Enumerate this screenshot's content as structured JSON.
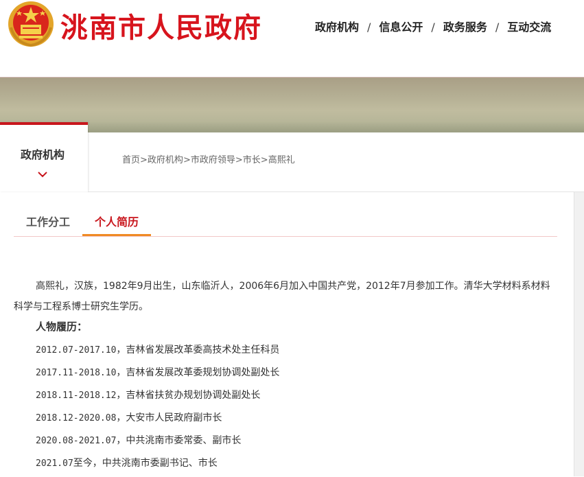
{
  "header": {
    "site_title": "洮南市人民政府",
    "emblem_icon": "national-emblem-icon",
    "nav": [
      "政府机构",
      "信息公开",
      "政务服务",
      "互动交流"
    ],
    "nav_separator": "/"
  },
  "colors": {
    "brand_red": "#c8161d",
    "tab_underline": "#f08a24"
  },
  "side_tab": {
    "label": "政府机构",
    "icon": "chevron-down-icon"
  },
  "breadcrumb": {
    "items": [
      "首页",
      "政府机构",
      "市政府领导",
      "市长",
      "高熙礼"
    ],
    "separator": ">"
  },
  "tabs": [
    {
      "label": "工作分工",
      "active": false
    },
    {
      "label": "个人简历",
      "active": true
    }
  ],
  "profile": {
    "intro": "高熙礼，汉族，1982年9月出生，山东临沂人，2006年6月加入中国共产党，2012年7月参加工作。清华大学材料系材料科学与工程系博士研究生学历。",
    "resume_heading": "人物履历：",
    "resume": [
      {
        "period": "2012.07-2017.10",
        "text": "，吉林省发展改革委高技术处主任科员"
      },
      {
        "period": "2017.11-2018.10",
        "text": "，吉林省发展改革委规划协调处副处长"
      },
      {
        "period": "2018.11-2018.12",
        "text": "，吉林省扶贫办规划协调处副处长"
      },
      {
        "period": "2018.12-2020.08",
        "text": "，大安市人民政府副市长"
      },
      {
        "period": "2020.08-2021.07",
        "text": "，中共洮南市委常委、副市长"
      },
      {
        "period": "2021.07",
        "text": "至今，中共洮南市委副书记、市长"
      }
    ]
  }
}
